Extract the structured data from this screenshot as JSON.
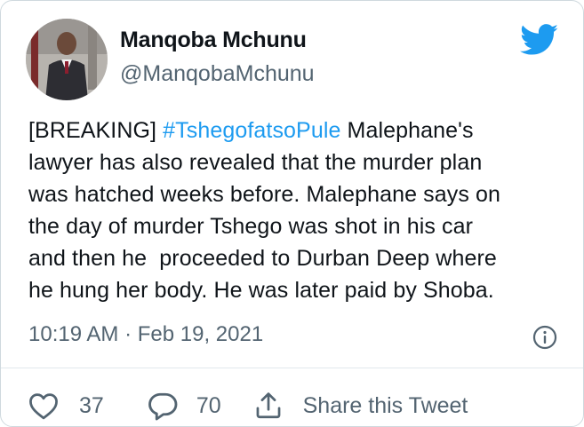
{
  "author": {
    "name": "Manqoba Mchunu",
    "handle": "@ManqobaMchunu",
    "avatar_icon": "profile-photo"
  },
  "tweet": {
    "lines": [
      {
        "prefix": "[BREAKING] ",
        "hashtag": "#TshegofatsoPule",
        "suffix": " Malephane's"
      },
      {
        "text": "lawyer has also revealed that the murder plan"
      },
      {
        "text": "was hatched weeks before. Malephane says on"
      },
      {
        "text": "the day of murder Tshego was shot in his car"
      },
      {
        "text": "and then he  proceeded to Durban Deep where"
      },
      {
        "text": "he hung her body. He was later paid by Shoba."
      }
    ],
    "timestamp": "10:19 AM · Feb 19, 2021"
  },
  "actions": {
    "likes": "37",
    "replies": "70",
    "share_label": "Share this Tweet"
  },
  "colors": {
    "brand": "#1d9bf0",
    "secondary_text": "#536471"
  },
  "icons": {
    "brand": "twitter-bird-icon",
    "info": "info-icon",
    "like": "heart-icon",
    "reply": "speech-bubble-icon",
    "share": "share-icon"
  }
}
